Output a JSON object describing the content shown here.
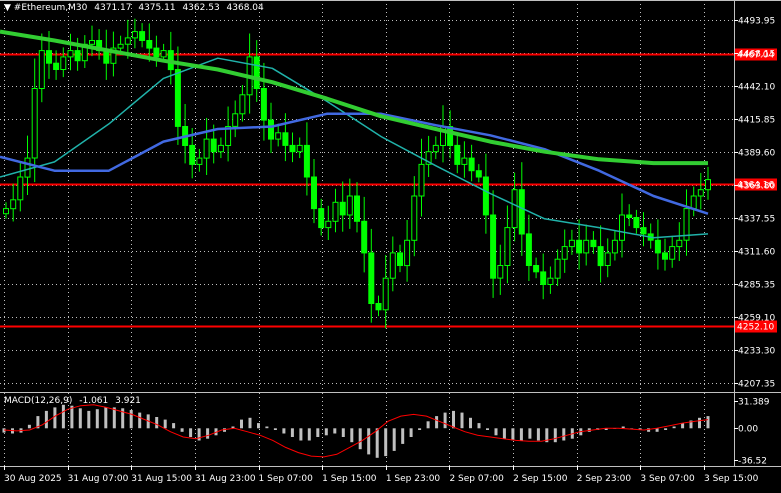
{
  "header": {
    "collapse_arrow": "▼",
    "symbol_timeframe": "#Ethereum,M30",
    "open": "4371.17",
    "high": "4375.11",
    "low": "4362.53",
    "close": "4368.04"
  },
  "price_axis": {
    "ticks": [
      "4493.95",
      "4468.15",
      "4442.10",
      "4415.85",
      "4389.60",
      "4363.80",
      "4337.55",
      "4311.60",
      "4285.35",
      "4259.10",
      "4233.30",
      "4207.35"
    ]
  },
  "levels": [
    {
      "label": "4467.04",
      "price": 4467.04
    },
    {
      "label": "4364.16",
      "price": 4364.16
    },
    {
      "label": "4252.10",
      "price": 4252.1
    }
  ],
  "macd": {
    "label": "MACD(12,26,9)",
    "main_value": "-1.061",
    "signal_value": "3.921",
    "ticks": [
      "31.389",
      "0.00",
      "-36.52"
    ]
  },
  "time_axis": {
    "labels": [
      "30 Aug 2025",
      "31 Aug 07:00",
      "31 Aug 15:00",
      "31 Aug 23:00",
      "1 Sep 07:00",
      "1 Sep 15:00",
      "1 Sep 23:00",
      "2 Sep 07:00",
      "2 Sep 15:00",
      "2 Sep 23:00",
      "3 Sep 07:00",
      "3 Sep 15:00"
    ]
  },
  "colors": {
    "background": "#000000",
    "candle": "#00ff00",
    "ma_slow": "#32cd32",
    "ma_mid": "#4169e1",
    "ma_fast": "#20b2aa",
    "level_line": "#ff0000",
    "level_label_bg": "#ff0000",
    "histogram": "#c0c0c0",
    "signal": "#ff0000",
    "axis_text": "#ffffff",
    "grid": "#c0c0c0"
  },
  "chart_data": {
    "type": "candlestick",
    "title": "#Ethereum,M30",
    "timeframe": "M30",
    "ylim": [
      4200,
      4510
    ],
    "current_price": 4368.04,
    "ohlc_last": {
      "open": 4371.17,
      "high": 4375.11,
      "low": 4362.53,
      "close": 4368.04
    },
    "horizontal_levels": [
      4467.04,
      4364.16,
      4252.1
    ],
    "close_path": [
      4345,
      4352,
      4370,
      4385,
      4440,
      4470,
      4460,
      4455,
      4465,
      4470,
      4462,
      4475,
      4478,
      4470,
      4460,
      4472,
      4475,
      4480,
      4485,
      4478,
      4472,
      4465,
      4470,
      4455,
      4410,
      4395,
      4380,
      4385,
      4400,
      4390,
      4395,
      4410,
      4420,
      4435,
      4465,
      4440,
      4415,
      4400,
      4405,
      4395,
      4390,
      4395,
      4370,
      4345,
      4330,
      4335,
      4350,
      4340,
      4355,
      4335,
      4310,
      4270,
      4265,
      4290,
      4310,
      4300,
      4320,
      4355,
      4380,
      4390,
      4395,
      4410,
      4395,
      4380,
      4385,
      4375,
      4370,
      4340,
      4290,
      4300,
      4330,
      4360,
      4325,
      4300,
      4295,
      4285,
      4290,
      4305,
      4315,
      4320,
      4310,
      4320,
      4315,
      4300,
      4310,
      4320,
      4340,
      4338,
      4330,
      4325,
      4320,
      4310,
      4305,
      4315,
      4320,
      4345,
      4355,
      4360,
      4368
    ],
    "moving_averages": [
      {
        "role": "slow",
        "y": [
          4485,
          4478,
          4470,
          4462,
          4455,
          4445,
          4432,
          4418,
          4408,
          4398,
          4390,
          4384,
          4381,
          4381
        ]
      },
      {
        "role": "mid",
        "y": [
          4386,
          4375,
          4375,
          4398,
          4408,
          4410,
          4420,
          4420,
          4411,
          4403,
          4392,
          4375,
          4355,
          4341
        ]
      },
      {
        "role": "fast",
        "y": [
          4370,
          4382,
          4412,
          4448,
          4464,
          4456,
          4430,
          4402,
          4379,
          4357,
          4337,
          4330,
          4322,
          4325
        ]
      }
    ],
    "macd": {
      "ylim": [
        -36.52,
        31.389
      ],
      "histogram": [
        -5,
        -6,
        -5,
        4,
        14,
        20,
        24,
        27,
        26,
        23,
        20,
        22,
        24,
        24,
        23,
        21,
        18,
        16,
        13,
        10,
        6,
        -4,
        -10,
        -14,
        -12,
        -8,
        -4,
        2,
        10,
        12,
        6,
        2,
        -2,
        -6,
        -10,
        -14,
        -14,
        -10,
        -8,
        -6,
        -10,
        -16,
        -24,
        -30,
        -34,
        -32,
        -26,
        -18,
        -10,
        -2,
        8,
        14,
        18,
        20,
        18,
        12,
        6,
        -2,
        -8,
        -12,
        -14,
        -14,
        -12,
        -14,
        -16,
        -16,
        -14,
        -12,
        -8,
        -4,
        -2,
        -2,
        0,
        2,
        0,
        -2,
        -4,
        -4,
        -2,
        2,
        6,
        9,
        12,
        14
      ],
      "signal": [
        -2,
        -3,
        -2,
        4,
        14,
        22,
        26,
        27,
        24,
        20,
        16,
        10,
        4,
        -4,
        -10,
        -12,
        -8,
        -2,
        0,
        -4,
        -8,
        -14,
        -22,
        -28,
        -32,
        -33,
        -30,
        -22,
        -14,
        -4,
        8,
        14,
        16,
        14,
        8,
        2,
        -4,
        -8,
        -10,
        -12,
        -14,
        -15,
        -15,
        -12,
        -8,
        -4,
        -2,
        0,
        0,
        -1,
        -2,
        0,
        3,
        6,
        8,
        10
      ]
    }
  }
}
